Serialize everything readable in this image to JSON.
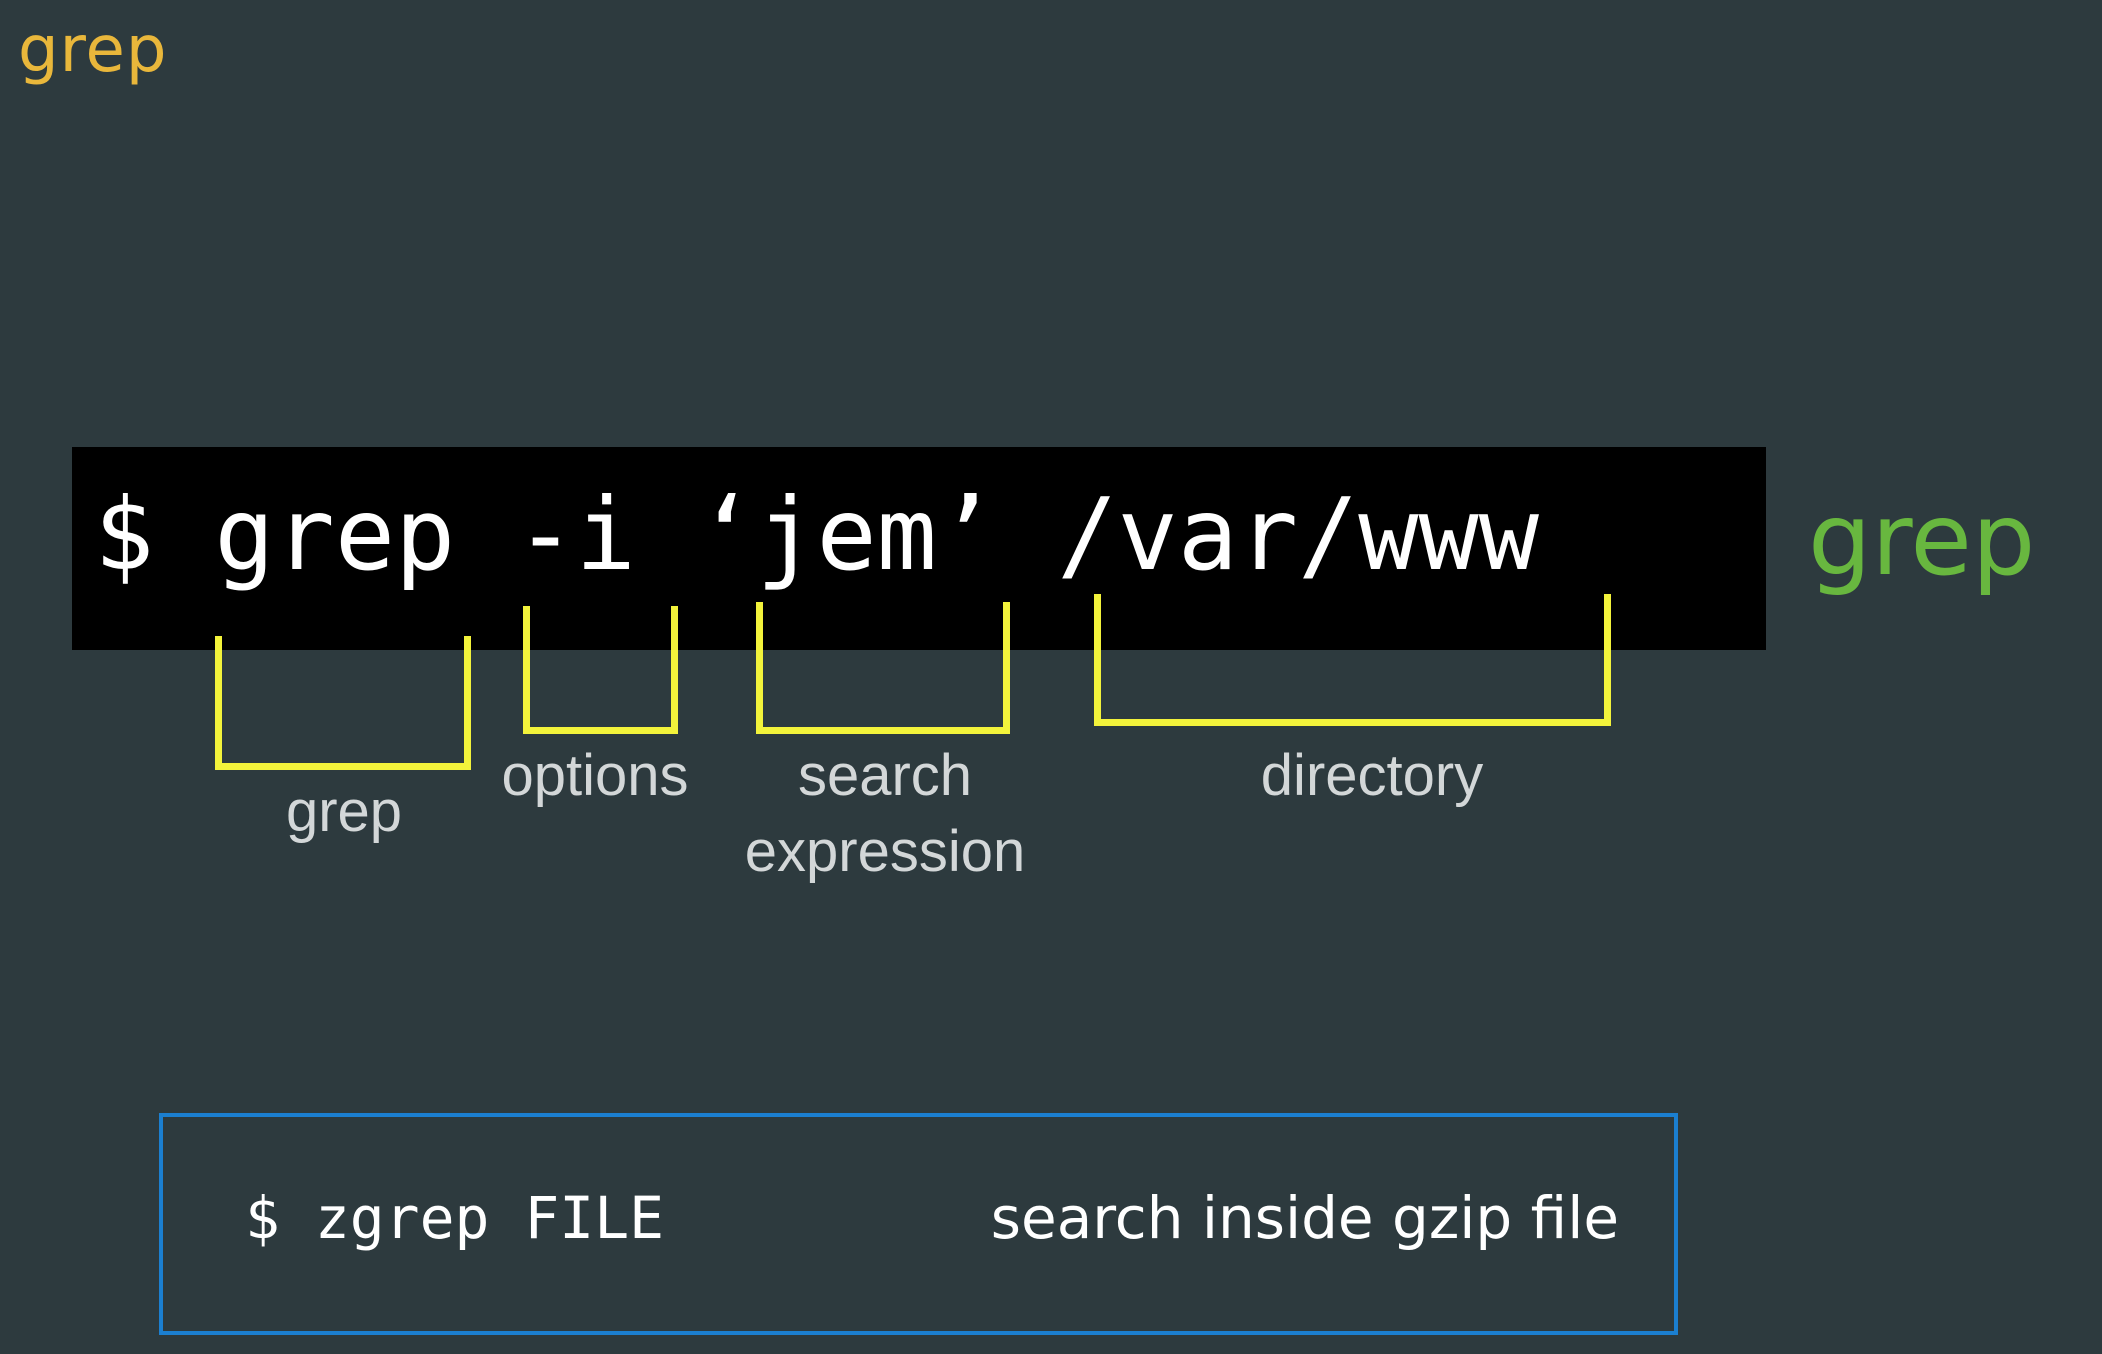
{
  "slide": {
    "title": "grep",
    "side_label": "grep"
  },
  "command": {
    "text": "$ grep -i ‘jem’ /var/www"
  },
  "annotations": {
    "grep": "grep",
    "options": "options",
    "search_expression": "search\nexpression",
    "directory": "directory"
  },
  "tip": {
    "command": "$ zgrep FILE",
    "description": "search inside gzip file"
  },
  "colors": {
    "background": "#2d3a3e",
    "title": "#e9b73b",
    "side_label": "#68b73f",
    "bracket": "#f3f33b",
    "tip_border": "#1b7fd0"
  }
}
